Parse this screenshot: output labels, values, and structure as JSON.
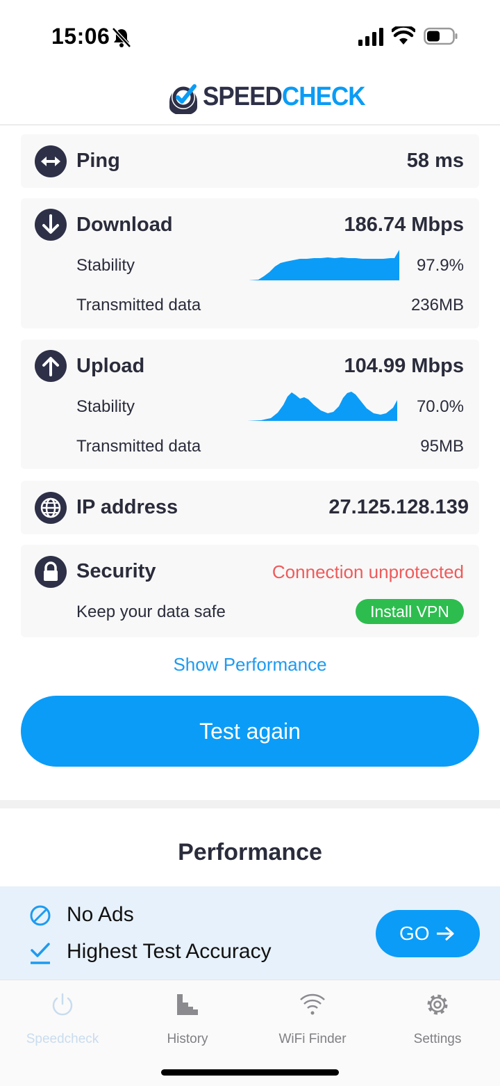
{
  "status_bar": {
    "time": "15:06"
  },
  "header": {
    "logo_part1": "SPEED",
    "logo_part2": "CHECK"
  },
  "ping": {
    "label": "Ping",
    "value": "58 ms"
  },
  "download": {
    "label": "Download",
    "value": "186.74 Mbps",
    "stability_label": "Stability",
    "stability_value": "97.9%",
    "data_label": "Transmitted data",
    "data_value": "236MB"
  },
  "upload": {
    "label": "Upload",
    "value": "104.99 Mbps",
    "stability_label": "Stability",
    "stability_value": "70.0%",
    "data_label": "Transmitted data",
    "data_value": "95MB"
  },
  "ip": {
    "label": "IP address",
    "value": "27.125.128.139"
  },
  "security": {
    "label": "Security",
    "status": "Connection unprotected",
    "sub_label": "Keep your data safe",
    "button": "Install VPN"
  },
  "show_performance": "Show Performance",
  "test_again": "Test again",
  "performance_title": "Performance",
  "promo": {
    "item1": "No Ads",
    "item2": "Highest Test Accuracy",
    "go": "GO"
  },
  "tabs": [
    {
      "label": "Speedcheck",
      "icon": "power-icon",
      "active": true
    },
    {
      "label": "History",
      "icon": "history-icon",
      "active": false
    },
    {
      "label": "WiFi Finder",
      "icon": "wifi-icon",
      "active": false
    },
    {
      "label": "Settings",
      "icon": "gear-icon",
      "active": false
    }
  ],
  "colors": {
    "accent": "#0b9cf7",
    "danger": "#f05a5a",
    "success": "#2dbd4e",
    "dark": "#2d3047"
  }
}
